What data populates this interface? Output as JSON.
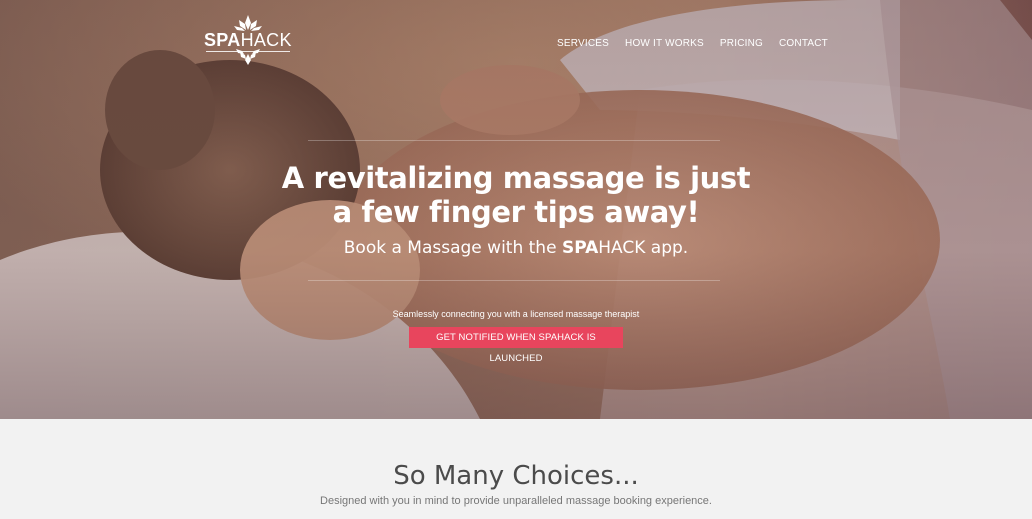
{
  "header": {
    "logo": {
      "text_bold": "SPA",
      "text_light": "HACK",
      "icon": "lotus-flower-icon"
    },
    "nav": [
      {
        "label": "SERVICES"
      },
      {
        "label": "HOW IT WORKS"
      },
      {
        "label": "PRICING"
      },
      {
        "label": "CONTACT"
      }
    ]
  },
  "hero": {
    "headline_line1": "A revitalizing massage is just",
    "headline_line2": "a few finger tips away!",
    "subhead_prefix": "Book a Massage with the ",
    "subhead_brand_bold": "SPA",
    "subhead_brand_light": "HACK",
    "subhead_suffix": " app.",
    "tagline": "Seamlessly connecting you with a licensed massage therapist",
    "cta_label": "GET NOTIFIED WHEN SPAHACK IS LAUNCHED"
  },
  "choices": {
    "title": "So Many Choices...",
    "subtitle": "Designed with you in mind to provide unparalleled massage booking experience."
  },
  "colors": {
    "accent": "#e8455d",
    "hero_overlay": "#6e4a44",
    "section_bg": "#f2f2f2",
    "title_text": "#4b4b4b"
  }
}
